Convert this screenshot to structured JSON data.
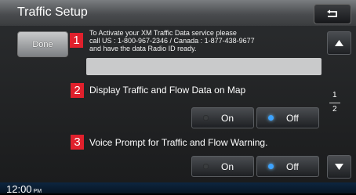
{
  "window": {
    "title": "Traffic Setup"
  },
  "header": {
    "back_icon": "return-arrow-icon"
  },
  "done_button": {
    "label": "Done"
  },
  "markers": [
    "1",
    "2",
    "3"
  ],
  "activation": {
    "lines": [
      "To Activate your XM Traffic Data service please",
      "call US : 1-800-967-2346 / Canada : 1-877-438-9677",
      "and have the data Radio ID ready."
    ],
    "radio_id_value": ""
  },
  "settings": [
    {
      "label": "Display Traffic and Flow Data on Map",
      "on_label": "On",
      "off_label": "Off",
      "selected": "Off"
    },
    {
      "label": "Voice Prompt for Traffic and Flow Warning.",
      "on_label": "On",
      "off_label": "Off",
      "selected": "Off"
    }
  ],
  "pagination": {
    "current": "1",
    "total": "2"
  },
  "status": {
    "time": "12:00",
    "ampm": "PM"
  },
  "colors": {
    "marker": "#e0202c",
    "selected_indicator": "#3ca3ff",
    "status_bar": "#0d2640"
  }
}
